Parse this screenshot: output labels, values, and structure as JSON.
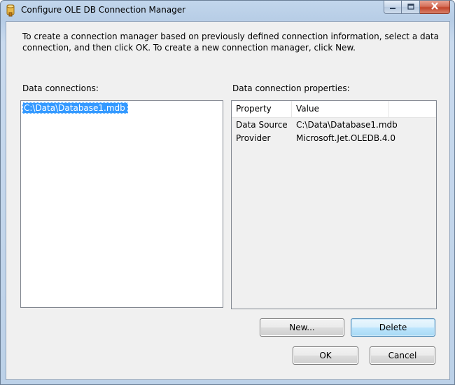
{
  "window": {
    "title": "Configure OLE DB Connection Manager",
    "caption_icons": [
      "minimize-icon",
      "maximize-icon",
      "close-icon"
    ]
  },
  "intro_text": "To create a connection manager based on previously defined connection information, select a data connection, and then click OK. To create a new connection manager, click New.",
  "data_connections": {
    "label": "Data connections:",
    "items": [
      "C:\\Data\\Database1.mdb"
    ],
    "selected_index": 0
  },
  "properties": {
    "label": "Data connection properties:",
    "columns": [
      "Property",
      "Value"
    ],
    "rows": [
      {
        "property": "Data Source",
        "value": "C:\\Data\\Database1.mdb"
      },
      {
        "property": "Provider",
        "value": "Microsoft.Jet.OLEDB.4.0"
      }
    ]
  },
  "buttons": {
    "new_label": "New...",
    "delete_label": "Delete",
    "ok_label": "OK",
    "cancel_label": "Cancel"
  },
  "colors": {
    "selection": "#3399ff",
    "dialog_bg": "#f0f0f0",
    "frame": "#b9cee7"
  }
}
